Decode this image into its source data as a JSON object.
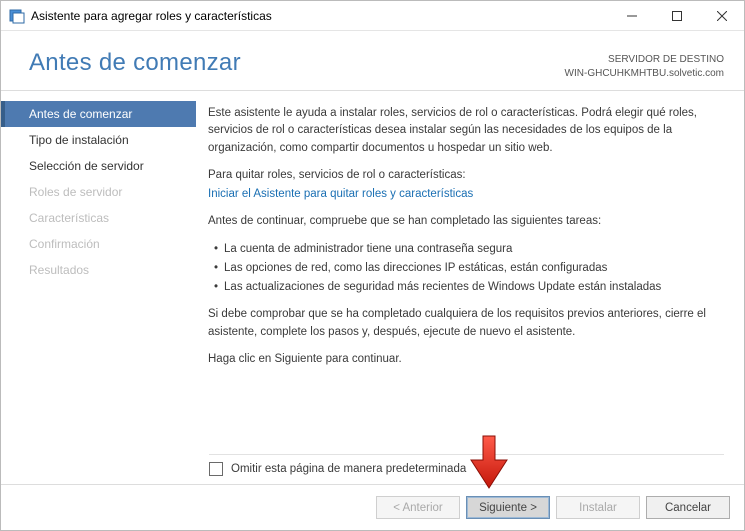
{
  "window": {
    "title": "Asistente para agregar roles y características"
  },
  "header": {
    "title": "Antes de comenzar",
    "dest_label": "SERVIDOR DE DESTINO",
    "dest_value": "WIN-GHCUHKMHTBU.solvetic.com"
  },
  "sidebar": {
    "items": [
      {
        "label": "Antes de comenzar",
        "state": "active"
      },
      {
        "label": "Tipo de instalación",
        "state": "enabled"
      },
      {
        "label": "Selección de servidor",
        "state": "enabled"
      },
      {
        "label": "Roles de servidor",
        "state": "disabled"
      },
      {
        "label": "Características",
        "state": "disabled"
      },
      {
        "label": "Confirmación",
        "state": "disabled"
      },
      {
        "label": "Resultados",
        "state": "disabled"
      }
    ]
  },
  "content": {
    "intro": "Este asistente le ayuda a instalar roles, servicios de rol o características. Podrá elegir qué roles, servicios de rol o características desea instalar según las necesidades de los equipos de la organización, como compartir documentos u hospedar un sitio web.",
    "remove_heading": "Para quitar roles, servicios de rol o características:",
    "remove_link": "Iniciar el Asistente para quitar roles y características",
    "before_heading": "Antes de continuar, compruebe que se han completado las siguientes tareas:",
    "bullets": [
      "La cuenta de administrador tiene una contraseña segura",
      "Las opciones de red, como las direcciones IP estáticas, están configuradas",
      "Las actualizaciones de seguridad más recientes de Windows Update están instaladas"
    ],
    "verify": "Si debe comprobar que se ha completado cualquiera de los requisitos previos anteriores, cierre el asistente, complete los pasos y, después, ejecute de nuevo el asistente.",
    "proceed": "Haga clic en Siguiente para continuar.",
    "skip_label": "Omitir esta página de manera predeterminada"
  },
  "buttons": {
    "previous": "< Anterior",
    "next": "Siguiente >",
    "install": "Instalar",
    "cancel": "Cancelar"
  }
}
